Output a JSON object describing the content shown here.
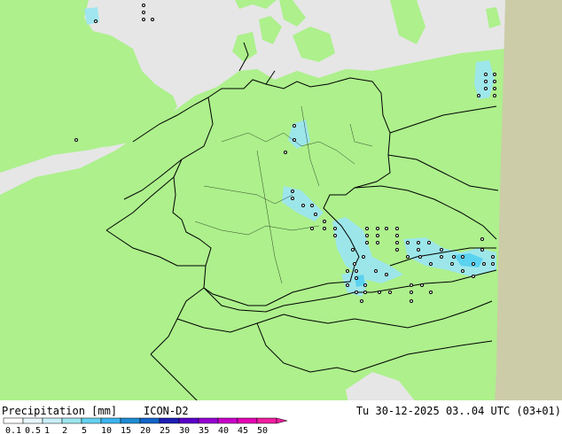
{
  "colors": {
    "land": "#adf08c",
    "sea": "#e6e6e6",
    "out_of_domain": "#cccca8",
    "border": "#000000",
    "precip_light": "#9ce6f0",
    "precip_mid": "#5ad2f0"
  },
  "footer": {
    "product": "Precipitation [mm]",
    "model": "ICON-D2",
    "valid_time": "Tu 30-12-2025 03..04 UTC (03+01)"
  },
  "scale": {
    "labels": [
      "0.1",
      "0.5",
      "1",
      "2",
      "5",
      "10",
      "15",
      "20",
      "25",
      "30",
      "35",
      "40",
      "45",
      "50"
    ],
    "colors": [
      "#ffffff",
      "#e6f8fc",
      "#c8f0fa",
      "#9ce6f0",
      "#64d2f0",
      "#3cb4f0",
      "#1e8cd2",
      "#1464c8",
      "#1e1eb4",
      "#5a00c8",
      "#9600d2",
      "#c800c8",
      "#e600b4",
      "#f01ea0"
    ]
  }
}
